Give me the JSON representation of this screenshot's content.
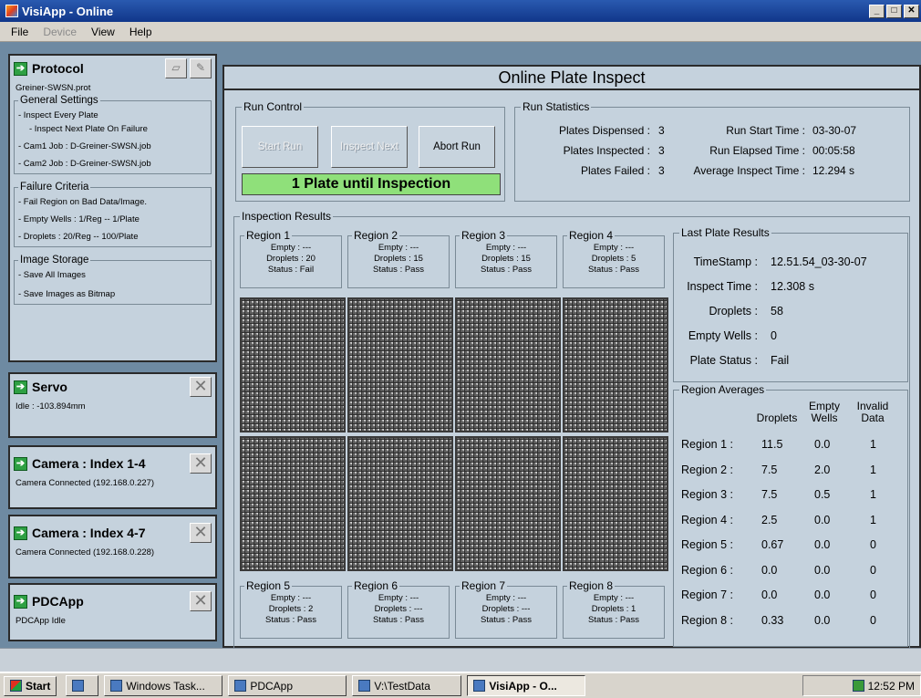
{
  "window": {
    "title": "VisiApp - Online"
  },
  "menu": {
    "file": "File",
    "device": "Device",
    "view": "View",
    "help": "Help"
  },
  "protocol": {
    "title": "Protocol",
    "file": "Greiner-SWSN.prot",
    "general_title": "General Settings",
    "general": [
      "- Inspect Every Plate",
      "- Inspect Next Plate On Failure",
      "- Cam1 Job : D-Greiner-SWSN.job",
      "- Cam2 Job : D-Greiner-SWSN.job"
    ],
    "failure_title": "Failure Criteria",
    "failure": [
      "- Fail Region on Bad Data/Image.",
      "- Empty Wells : 1/Reg -- 1/Plate",
      "- Droplets : 20/Reg -- 100/Plate"
    ],
    "storage_title": "Image Storage",
    "storage": [
      "- Save All Images",
      "- Save Images as Bitmap"
    ]
  },
  "servo": {
    "title": "Servo",
    "status": "Idle : -103.894mm"
  },
  "camera1": {
    "title": "Camera : Index 1-4",
    "status": "Camera Connected (192.168.0.227)"
  },
  "camera2": {
    "title": "Camera : Index 4-7",
    "status": "Camera Connected (192.168.0.228)"
  },
  "pdcapp": {
    "title": "PDCApp",
    "status": "PDCApp Idle"
  },
  "main": {
    "title": "Online Plate Inspect"
  },
  "run_control": {
    "title": "Run Control",
    "start": "Start Run",
    "inspect_next": "Inspect Next",
    "abort": "Abort Run",
    "message": "1 Plate until Inspection"
  },
  "run_stats": {
    "title": "Run Statistics",
    "dispensed_label": "Plates Dispensed :",
    "dispensed": "3",
    "inspected_label": "Plates Inspected :",
    "inspected": "3",
    "failed_label": "Plates Failed :",
    "failed": "3",
    "start_label": "Run Start Time :",
    "start": "03-30-07",
    "elapsed_label": "Run Elapsed Time :",
    "elapsed": "00:05:58",
    "avg_label": "Average Inspect Time :",
    "avg": "12.294 s"
  },
  "inspection": {
    "title": "Inspection Results",
    "regions": [
      {
        "name": "Region 1",
        "empty": "Empty : ---",
        "droplets": "Droplets : 20",
        "status": "Status : Fail"
      },
      {
        "name": "Region 2",
        "empty": "Empty : ---",
        "droplets": "Droplets : 15",
        "status": "Status : Pass"
      },
      {
        "name": "Region 3",
        "empty": "Empty : ---",
        "droplets": "Droplets : 15",
        "status": "Status : Pass"
      },
      {
        "name": "Region 4",
        "empty": "Empty : ---",
        "droplets": "Droplets : 5",
        "status": "Status : Pass"
      },
      {
        "name": "Region 5",
        "empty": "Empty : ---",
        "droplets": "Droplets : 2",
        "status": "Status : Pass"
      },
      {
        "name": "Region 6",
        "empty": "Empty : ---",
        "droplets": "Droplets : ---",
        "status": "Status : Pass"
      },
      {
        "name": "Region 7",
        "empty": "Empty : ---",
        "droplets": "Droplets : ---",
        "status": "Status : Pass"
      },
      {
        "name": "Region 8",
        "empty": "Empty : ---",
        "droplets": "Droplets : 1",
        "status": "Status : Pass"
      }
    ]
  },
  "last_plate": {
    "title": "Last Plate Results",
    "timestamp_label": "TimeStamp :",
    "timestamp": "12.51.54_03-30-07",
    "inspect_label": "Inspect Time :",
    "inspect": "12.308 s",
    "droplets_label": "Droplets :",
    "droplets": "58",
    "empty_label": "Empty Wells :",
    "empty": "0",
    "status_label": "Plate Status :",
    "status": "Fail"
  },
  "region_averages": {
    "title": "Region Averages",
    "col_droplets": "Droplets",
    "col_empty": "Empty Wells",
    "col_invalid": "Invalid Data",
    "rows": [
      {
        "label": "Region 1 :",
        "droplets": "11.5",
        "empty": "0.0",
        "invalid": "1"
      },
      {
        "label": "Region 2 :",
        "droplets": "7.5",
        "empty": "2.0",
        "invalid": "1"
      },
      {
        "label": "Region 3 :",
        "droplets": "7.5",
        "empty": "0.5",
        "invalid": "1"
      },
      {
        "label": "Region 4 :",
        "droplets": "2.5",
        "empty": "0.0",
        "invalid": "1"
      },
      {
        "label": "Region 5 :",
        "droplets": "0.67",
        "empty": "0.0",
        "invalid": "0"
      },
      {
        "label": "Region 6 :",
        "droplets": "0.0",
        "empty": "0.0",
        "invalid": "0"
      },
      {
        "label": "Region 7 :",
        "droplets": "0.0",
        "empty": "0.0",
        "invalid": "0"
      },
      {
        "label": "Region 8 :",
        "droplets": "0.33",
        "empty": "0.0",
        "invalid": "0"
      }
    ]
  },
  "taskbar": {
    "start": "Start",
    "items": [
      "Windows Task...",
      "PDCApp",
      "V:\\TestData",
      "VisiApp - O..."
    ],
    "clock": "12:52 PM"
  },
  "icons": [
    "app-icon",
    "arrow-right-icon",
    "folder-open-icon",
    "edit-icon",
    "close-x-icon",
    "windows-logo-icon"
  ]
}
